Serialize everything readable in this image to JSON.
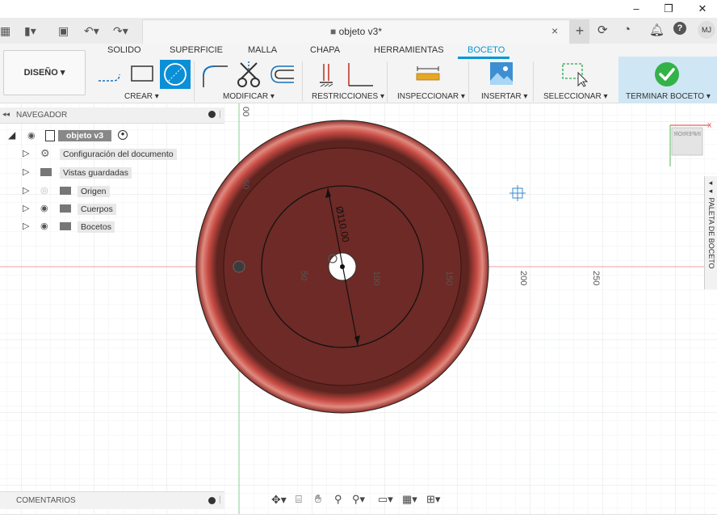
{
  "window": {
    "minimize_glyph": "–",
    "restore_glyph": "❐",
    "close_glyph": "✕"
  },
  "document": {
    "title": "objeto v3*",
    "close_glyph": "×",
    "user_initials": "MJ"
  },
  "ribbon": {
    "tabs": [
      "SOLIDO",
      "SUPERFICIE",
      "MALLA",
      "CHAPA",
      "HERRAMIENTAS",
      "BOCETO"
    ],
    "active_tab": "BOCETO",
    "workspace_label": "DISEÑO ▾",
    "groups": [
      "CREAR ▾",
      "MODIFICAR ▾",
      "RESTRICCIONES ▾",
      "INSPECCIONAR ▾",
      "INSERTAR ▾",
      "SELECCIONAR ▾",
      "TERMINAR BOCETO ▾"
    ]
  },
  "navigator": {
    "title": "NAVEGADOR",
    "root": "objeto v3",
    "items": [
      "Configuración del documento",
      "Vistas guardadas",
      "Origen",
      "Cuerpos",
      "Bocetos"
    ]
  },
  "canvas": {
    "dimension_label": "Ø110.00",
    "ruler_labels": [
      "50",
      "100",
      "150",
      "200",
      "250"
    ],
    "vertical_ruler": [
      "00",
      "50"
    ],
    "viewcube_face": "INFERIOR"
  },
  "comments": {
    "title": "COMENTARIOS"
  },
  "sketch_palette": {
    "title": "PALETA DE BOCETO"
  },
  "colors": {
    "accent": "#0696d7",
    "body_fill": "#6e2a26",
    "rim": "#c0413a",
    "finish_green": "#33b24a"
  }
}
